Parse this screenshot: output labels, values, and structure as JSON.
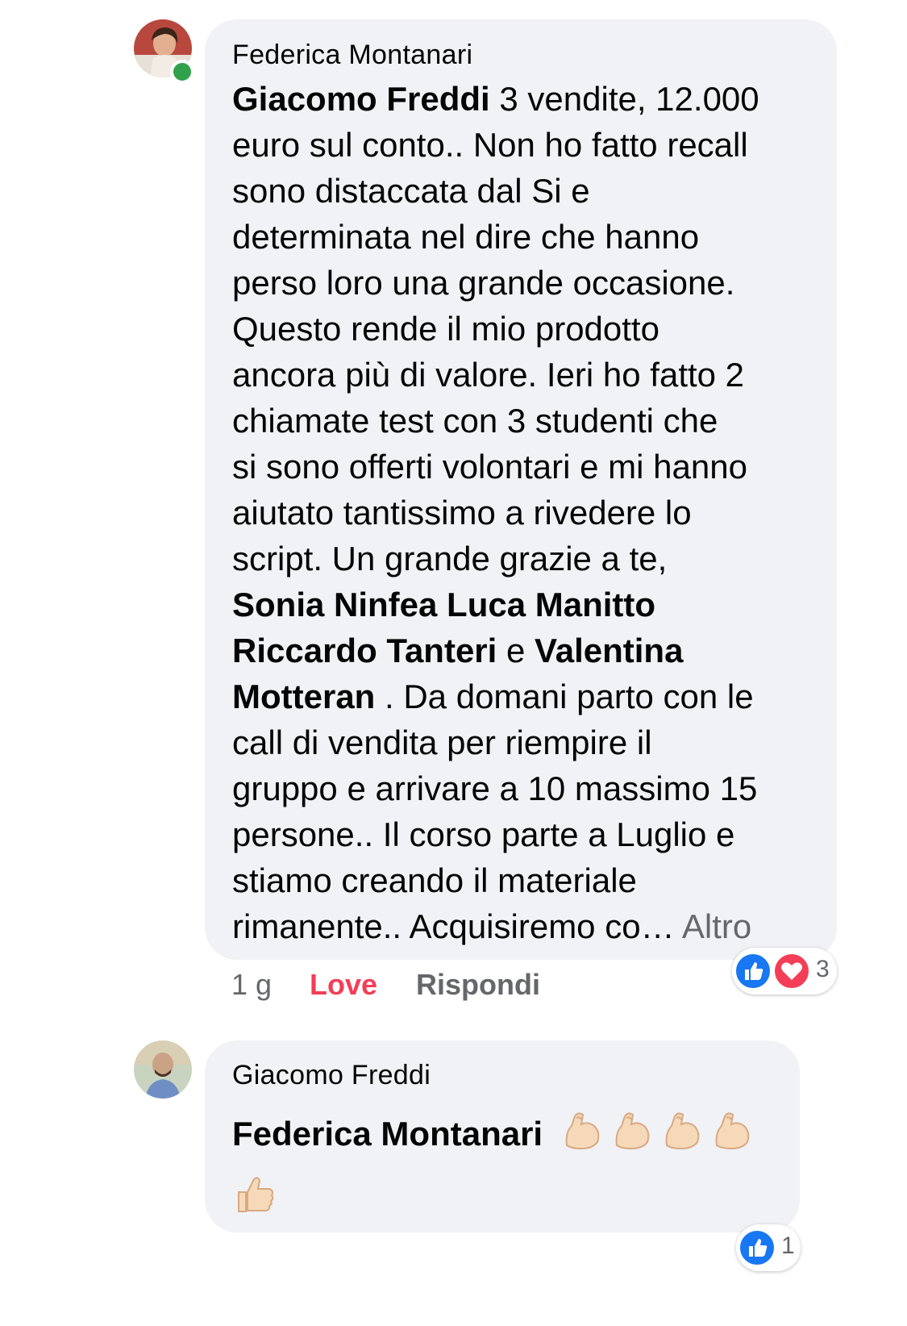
{
  "comments": [
    {
      "author": "Federica Montanari",
      "online": true,
      "lines": [
        [
          {
            "t": "Giacomo Freddi",
            "b": true
          },
          {
            "t": " 3 vendite, 12.000"
          }
        ],
        [
          {
            "t": "euro sul conto.. Non ho fatto recall"
          }
        ],
        [
          {
            "t": "sono distaccata dal Si e"
          }
        ],
        [
          {
            "t": "determinata nel dire che hanno"
          }
        ],
        [
          {
            "t": "perso loro una grande occasione."
          }
        ],
        [
          {
            "t": "Questo rende il mio prodotto"
          }
        ],
        [
          {
            "t": "ancora più di valore. Ieri ho fatto 2"
          }
        ],
        [
          {
            "t": "chiamate test con 3 studenti che"
          }
        ],
        [
          {
            "t": "si sono offerti volontari e mi hanno"
          }
        ],
        [
          {
            "t": "aiutato tantissimo a rivedere lo"
          }
        ],
        [
          {
            "t": "script. Un grande grazie a te,"
          }
        ],
        [
          {
            "t": "Sonia Ninfea Luca Manitto",
            "b": true
          }
        ],
        [
          {
            "t": "Riccardo Tanteri",
            "b": true
          },
          {
            "t": " e "
          },
          {
            "t": "Valentina",
            "b": true
          }
        ],
        [
          {
            "t": "Motteran",
            "b": true
          },
          {
            "t": " . Da domani parto con le"
          }
        ],
        [
          {
            "t": "call di vendita per riempire il"
          }
        ],
        [
          {
            "t": "gruppo e arrivare a 10 massimo 15"
          }
        ],
        [
          {
            "t": "persone.. Il corso parte a Luglio e"
          }
        ],
        [
          {
            "t": "stiamo creando il materiale"
          }
        ],
        [
          {
            "t": "rimanente.. Acquisiremo co… "
          },
          {
            "t": "Altro",
            "more": true
          }
        ]
      ],
      "time": "1 g",
      "love_label": "Love",
      "reply_label": "Rispondi",
      "reaction_count": "3",
      "reaction_icons": [
        "like-icon",
        "love-icon"
      ]
    },
    {
      "author": "Giacomo Freddi",
      "mention": "Federica Montanari",
      "emojis": [
        "flexed-biceps-icon",
        "flexed-biceps-icon",
        "flexed-biceps-icon",
        "flexed-biceps-icon",
        "thumbs-up-icon"
      ],
      "reaction_count": "1",
      "reaction_icons": [
        "like-icon"
      ]
    }
  ],
  "colors": {
    "bubble": "#f0f2f5",
    "love": "#f33e58",
    "meta": "#65676b",
    "online": "#31a24c",
    "like_blue": "#1877f2"
  }
}
